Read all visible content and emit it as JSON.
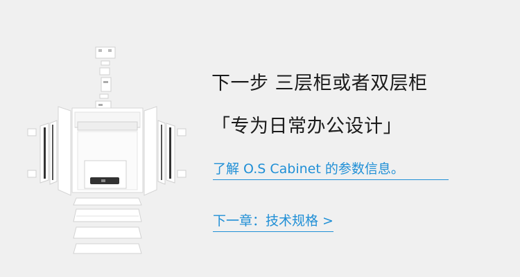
{
  "headline": {
    "title": "下一步 三层柜或者双层柜",
    "subtitle": "「专为日常办公设计」"
  },
  "links": {
    "params_label": "了解 O.S Cabinet 的参数信息。",
    "next_chapter_label": "下一章：技术规格 >"
  },
  "colors": {
    "background": "#f0f0f0",
    "heading_text": "#1b1b1b",
    "link": "#1f8fd6"
  },
  "illustration": {
    "subject": "exploded-view-of-cabinet"
  }
}
